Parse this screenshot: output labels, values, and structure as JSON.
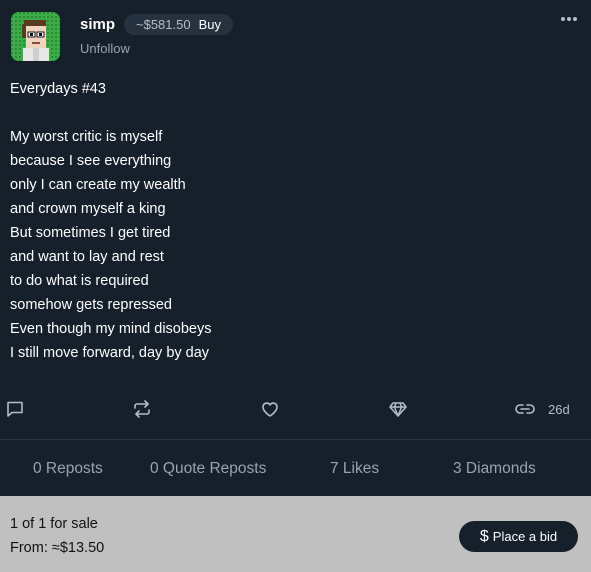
{
  "post": {
    "username": "simp",
    "price": "~$581.50",
    "buy_label": "Buy",
    "unfollow_label": "Unfollow",
    "title": "Everydays #43",
    "lines": [
      "My worst critic is myself",
      "because I see everything",
      "only I can create my wealth",
      "and crown myself a king",
      "But sometimes I get tired",
      "and want to lay and rest",
      "to do what is required",
      "somehow gets repressed",
      "Even though my mind disobeys",
      "I still move forward, day by day"
    ],
    "age": "26d"
  },
  "actions": {
    "icons": [
      "comment-icon",
      "repost-icon",
      "heart-icon",
      "diamond-icon",
      "link-icon"
    ]
  },
  "stats": {
    "reposts": "0 Reposts",
    "quote_reposts": "0 Quote Reposts",
    "likes": "7 Likes",
    "diamonds": "3 Diamonds"
  },
  "sale": {
    "count_text": "1 of 1 for sale",
    "from_text": "From: ≈$13.50",
    "bid_icon": "$",
    "bid_label": "Place a bid"
  },
  "colors": {
    "background": "#16202b",
    "sale_panel": "#c0c0c0",
    "muted_text": "#9aa4af",
    "pill_bg": "#26323f"
  }
}
